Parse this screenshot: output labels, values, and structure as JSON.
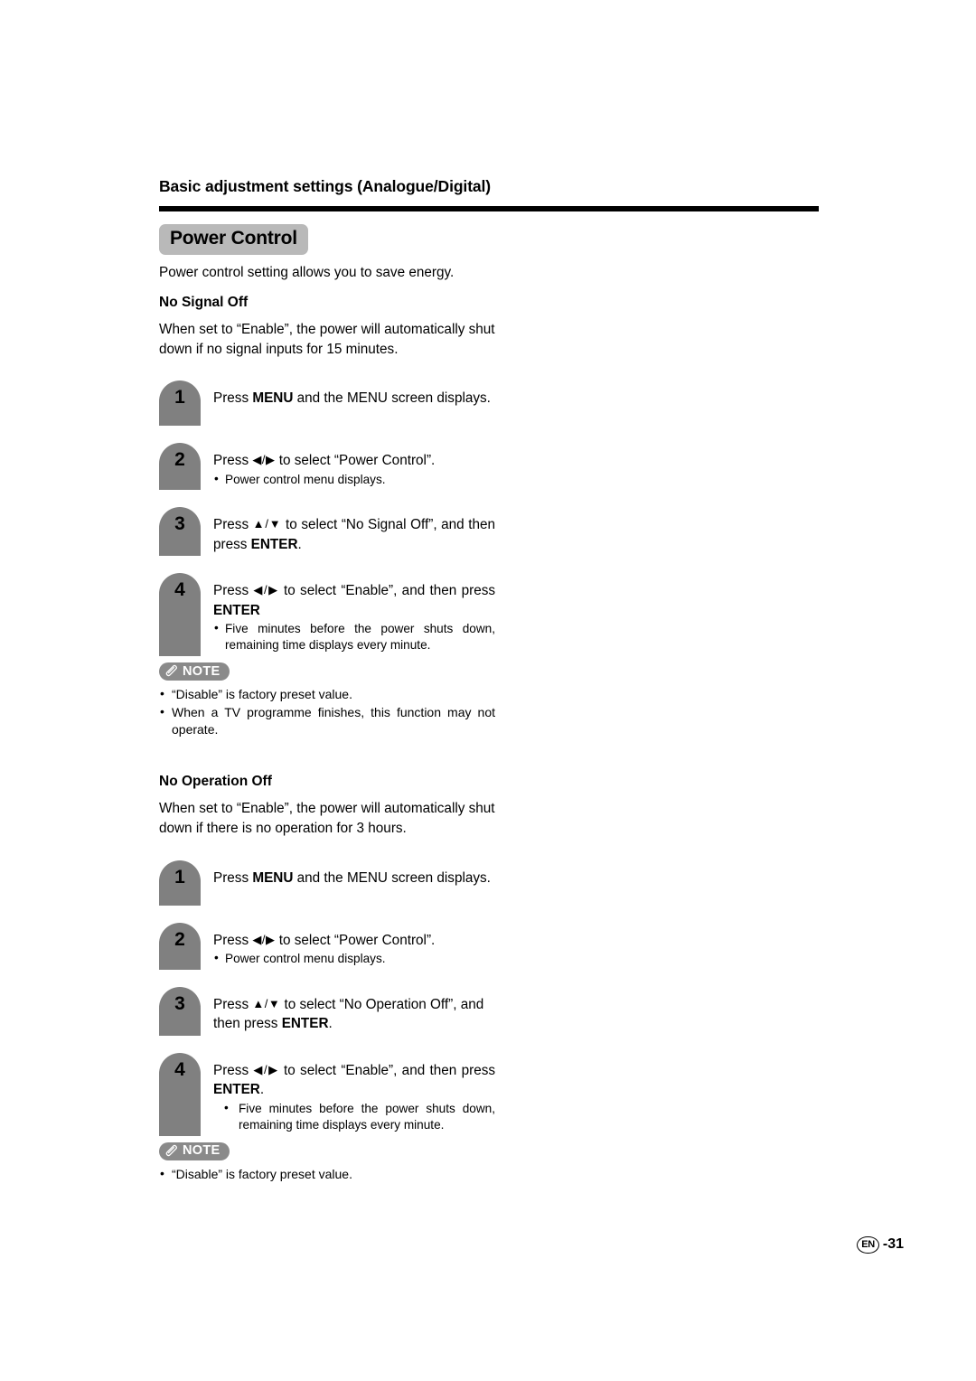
{
  "page": {
    "header": "Basic adjustment settings (Analogue/Digital)",
    "section_title": "Power Control",
    "intro": "Power control setting allows you to save energy.",
    "footer_lang": "EN",
    "footer_page": "-31"
  },
  "colors": {
    "badge_gray": "#808080",
    "chip_gray": "#b9b9b9",
    "note_gray": "#8a8a8a",
    "rule_black": "#000000"
  },
  "icons": {
    "note_pen": "pencil-icon",
    "left_right": "◀/▶",
    "up_down": "▲/▼"
  },
  "sections": [
    {
      "heading": "No Signal Off",
      "description_l1": "When set to “Enable”, the power will automatically shut",
      "description_l2": "down if no signal inputs for 15 minutes.",
      "steps": [
        {
          "number": "1",
          "text_pre": "Press ",
          "text_bold": "MENU",
          "text_post": " and the MENU screen displays.",
          "bullets": []
        },
        {
          "number": "2",
          "text_pre": "Press ",
          "text_arrows": "◀/▶",
          "text_post": " to select “Power Control”.",
          "bullets": [
            "Power control menu displays."
          ]
        },
        {
          "number": "3",
          "text_pre": "Press ",
          "text_arrows": "▲/▼",
          "text_mid": " to select “No Signal Off”, and then press ",
          "text_bold": "ENTER",
          "text_post": ".",
          "bullets": []
        },
        {
          "number": "4",
          "text_pre": "Press ",
          "text_arrows": "◀/▶",
          "text_mid": " to select “Enable”, and then press ",
          "text_bold": "ENTER",
          "text_post": "",
          "bullets": [
            "Five minutes before the power shuts down, remaining time displays every minute."
          ]
        }
      ],
      "note": {
        "label": "NOTE",
        "items": [
          "“Disable” is factory preset value.",
          "When a TV programme finishes, this function may not operate."
        ]
      }
    },
    {
      "heading": "No Operation Off",
      "description_l1": "When set to “Enable”, the power will automatically shut",
      "description_l2": "down if there is no operation for 3 hours.",
      "steps": [
        {
          "number": "1",
          "text_pre": "Press ",
          "text_bold": "MENU",
          "text_post": " and the MENU screen displays.",
          "bullets": []
        },
        {
          "number": "2",
          "text_pre": "Press ",
          "text_arrows": "◀/▶",
          "text_post": " to select “Power Control”.",
          "bullets": [
            "Power control menu displays."
          ]
        },
        {
          "number": "3",
          "text_pre": "Press ",
          "text_arrows": "▲/▼",
          "text_mid": " to select “No Operation Off”, and then press ",
          "text_bold": "ENTER",
          "text_post": ".",
          "bullets": []
        },
        {
          "number": "4",
          "text_pre": "Press ",
          "text_arrows": "◀/▶",
          "text_mid": " to select “Enable”, and then press ",
          "text_bold": "ENTER",
          "text_post": ".",
          "bullets": [
            "Five minutes before the power shuts down, remaining time displays every minute."
          ]
        }
      ],
      "note": {
        "label": "NOTE",
        "items": [
          "“Disable” is factory preset value."
        ]
      }
    }
  ]
}
